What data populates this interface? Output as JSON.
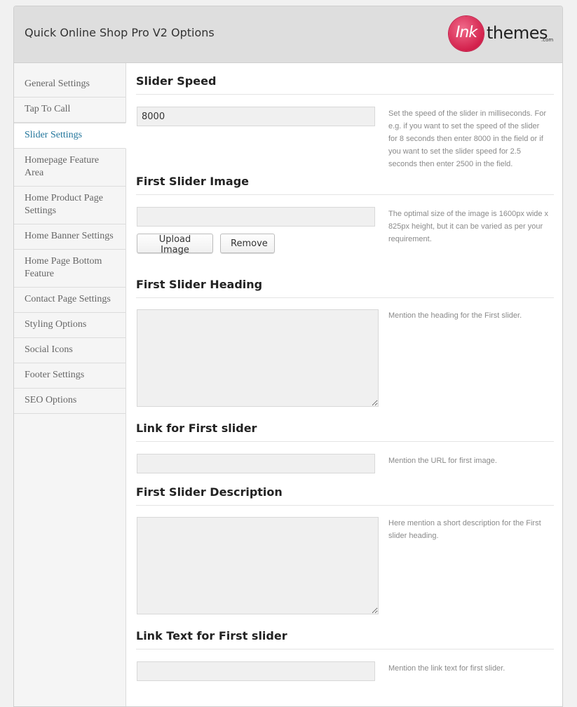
{
  "header": {
    "title": "Quick Online Shop Pro V2 Options",
    "logo_mark": "Ink",
    "logo_word": "themes",
    "logo_suffix": ".com",
    "brand_color": "#d3214c"
  },
  "sidebar": {
    "items": [
      {
        "label": "General Settings"
      },
      {
        "label": "Tap To Call"
      },
      {
        "label": "Slider Settings",
        "active": true
      },
      {
        "label": "Homepage Feature Area"
      },
      {
        "label": "Home Product Page Settings"
      },
      {
        "label": "Home Banner Settings"
      },
      {
        "label": "Home Page Bottom Feature"
      },
      {
        "label": "Contact Page Settings"
      },
      {
        "label": "Styling Options"
      },
      {
        "label": "Social Icons"
      },
      {
        "label": "Footer Settings"
      },
      {
        "label": "SEO Options"
      }
    ],
    "active_color": "#21759b"
  },
  "sections": {
    "slider_speed": {
      "title": "Slider Speed",
      "value": "8000",
      "help": "Set the speed of the slider in milliseconds. For e.g. if you want to set the speed of the slider for 8 seconds then enter 8000 in the field or if you want to set the slider speed for 2.5 seconds then enter 2500 in the field."
    },
    "first_slider_image": {
      "title": "First Slider Image",
      "value": "",
      "upload_label": "Upload Image",
      "remove_label": "Remove",
      "help": "The optimal size of the image is 1600px wide x 825px height, but it can be varied as per your requirement."
    },
    "first_slider_heading": {
      "title": "First Slider Heading",
      "value": "",
      "help": "Mention the heading for the First slider."
    },
    "first_slider_link": {
      "title": "Link for First slider",
      "value": "",
      "help": "Mention the URL for first image."
    },
    "first_slider_description": {
      "title": "First Slider Description",
      "value": "",
      "help": "Here mention a short description for the First slider heading."
    },
    "first_slider_link_text": {
      "title": "Link Text for First slider",
      "value": "",
      "help": "Mention the link text for first slider."
    }
  }
}
